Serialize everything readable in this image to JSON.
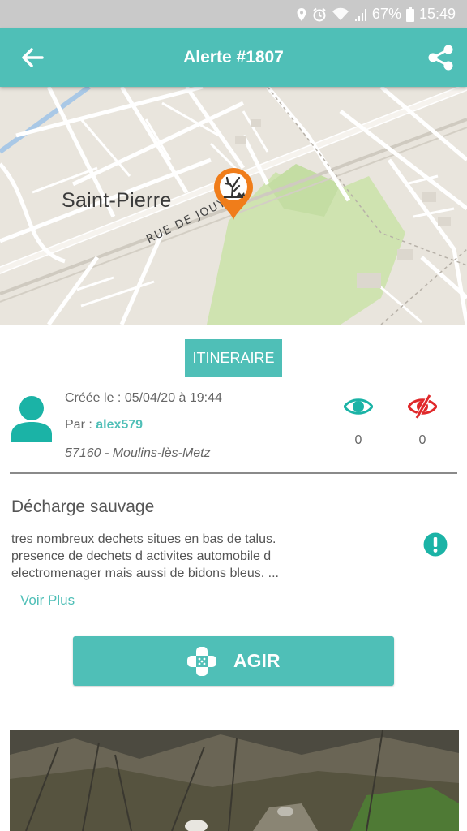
{
  "status_bar": {
    "battery": "67%",
    "time": "15:49",
    "icons": [
      "location-icon",
      "alarm-icon",
      "wifi-icon",
      "signal-icon",
      "battery-icon"
    ]
  },
  "app_bar": {
    "title": "Alerte #1807",
    "back_icon": "arrow-left-icon",
    "share_icon": "share-icon",
    "color": "#4fbfb7"
  },
  "map": {
    "city_label": "Saint-Pierre",
    "road_label": "RUE DE JOUY",
    "marker_icon": "dead-tree-pin-icon",
    "marker_color": "#f07d1a"
  },
  "itinerary_button": {
    "label": "ITINERAIRE"
  },
  "report_info": {
    "created": "Créée le : 05/04/20 à 19:44",
    "author_prefix": "Par : ",
    "author": "alex579",
    "location": "57160 - Moulins-lès-Metz",
    "seen_count": "0",
    "not_seen_count": "0"
  },
  "alert": {
    "title": "Décharge sauvage",
    "description_lines": [
      "tres nombreux dechets situes en bas de talus.",
      "presence de dechets d activites automobile  d",
      "electromenager mais aussi de bidons bleus.  ..."
    ],
    "see_more": "Voir Plus"
  },
  "action_button": {
    "label": "AGIR",
    "icon": "bandage-icon"
  },
  "colors": {
    "accent": "#4fbfb7",
    "danger": "#e0282a",
    "status_bar": "#c9c9c9"
  }
}
